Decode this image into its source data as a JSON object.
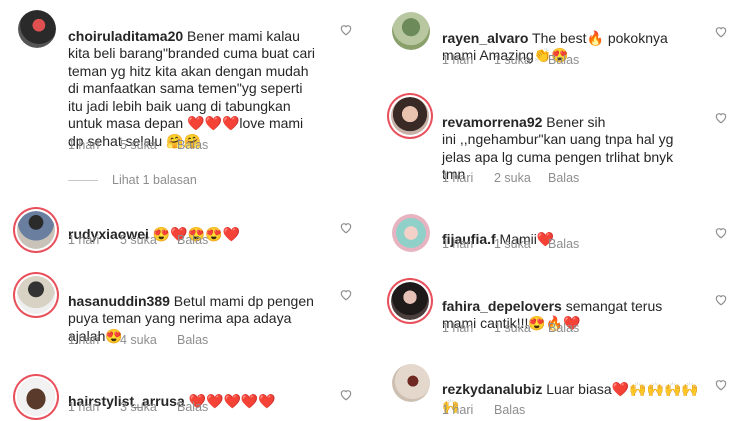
{
  "comments_left": [
    {
      "username": "choiruladitama20",
      "text": " Bener mami kalau\nkita beli barang\"branded cuma buat cari\nteman yg hitz kita akan dengan mudah\ndi manfaatkan sama temen\"yg seperti\nitu jadi lebih baik uang di tabungkan\nuntuk masa depan ❤️❤️❤️love mami\ndp sehat selalu 🤗🤗",
      "time": "1 hari",
      "likes": "5 suka",
      "reply": "Balas",
      "view_replies": "Lihat 1 balasan"
    },
    {
      "username": "rudyxiaowei",
      "text": " 😍❤️😍😍❤️",
      "time": "1 hari",
      "likes": "5 suka",
      "reply": "Balas"
    },
    {
      "username": "hasanuddin389",
      "text": " Betul mami dp pengen\npuya teman yang nerima apa adaya\najalah😍",
      "time": "1 hari",
      "likes": "4 suka",
      "reply": "Balas"
    },
    {
      "username": "hairstylist_arrusa",
      "text": " ❤️❤️❤️❤️❤️",
      "time": "1 hari",
      "likes": "3 suka",
      "reply": "Balas"
    }
  ],
  "comments_right": [
    {
      "username": "rayen_alvaro",
      "text": " The best🔥 pokoknya\nmami Amazing👏😍",
      "time": "1 hari",
      "likes": "1 suka",
      "reply": "Balas"
    },
    {
      "username": "revamorrena92",
      "text": " Bener sih\nini ,,ngehambur\"kan uang tnpa hal yg\njelas apa lg cuma pengen trlihat bnyk\ntmn",
      "time": "1 hari",
      "likes": "2 suka",
      "reply": "Balas"
    },
    {
      "username": "fijaufia.f",
      "text": " Mamii❤️",
      "time": "1 hari",
      "likes": "1 suka",
      "reply": "Balas"
    },
    {
      "username": "fahira_depelovers",
      "text": " semangat terus\nmami cantik!!!😍🔥❤️",
      "time": "1 hari",
      "likes": "1 suka",
      "reply": "Balas"
    },
    {
      "username": "rezkydanalubiz",
      "text": " Luar biasa❤️🙌🙌🙌🙌\n🙌",
      "time": "1 hari",
      "reply": "Balas"
    }
  ],
  "icons": {
    "like": "heart-outline-icon"
  },
  "colors": {
    "story_ring": "#e8505b",
    "meta_text": "#8e8e8e",
    "text": "#262626"
  }
}
